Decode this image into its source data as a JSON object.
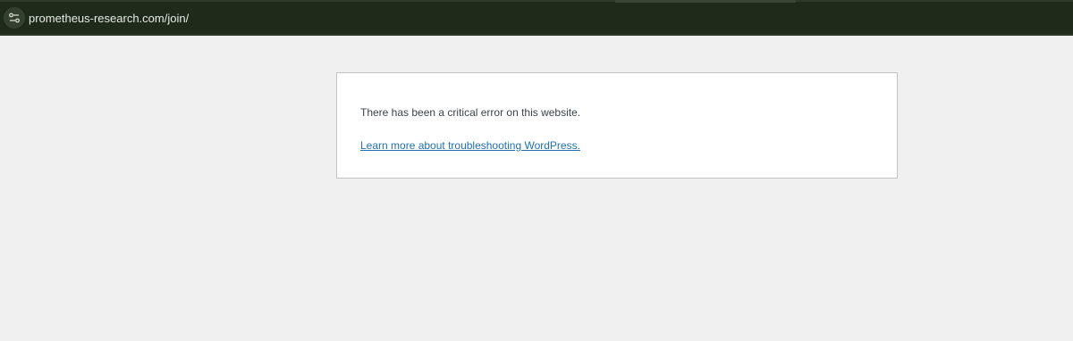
{
  "browser": {
    "url": "prometheus-research.com/join/",
    "site_info_icon": "tune-icon"
  },
  "error": {
    "message": "There has been a critical error on this website.",
    "help_link_text": "Learn more about troubleshooting WordPress."
  },
  "colors": {
    "toolbar_bg": "#1e2a1a",
    "page_bg": "#f0f0f1",
    "link": "#2271b1",
    "text": "#3c434a"
  }
}
